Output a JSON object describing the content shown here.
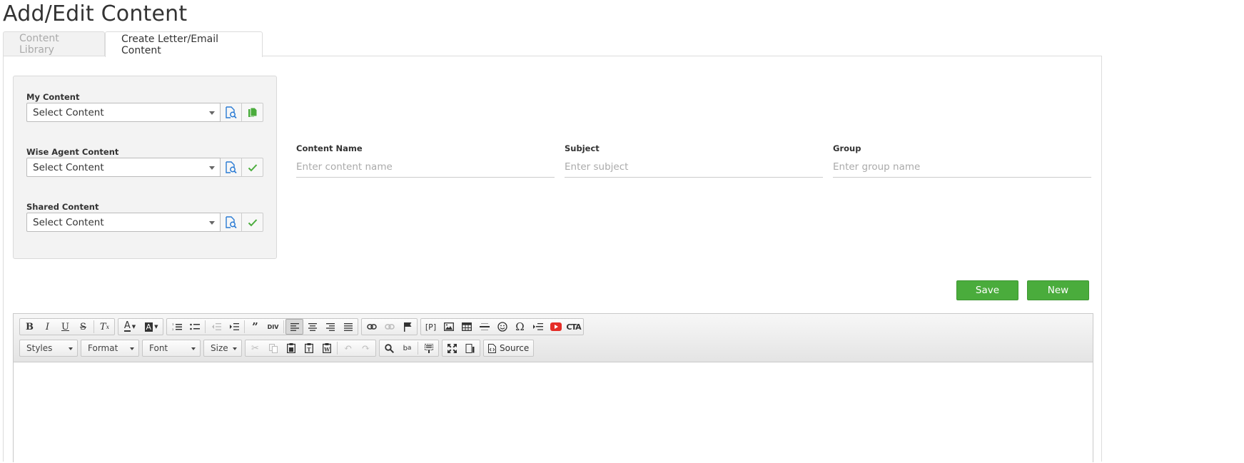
{
  "page": {
    "title": "Add/Edit Content"
  },
  "tabs": [
    {
      "label": "Content Library",
      "active": false
    },
    {
      "label": "Create Letter/Email Content",
      "active": true
    }
  ],
  "sources": [
    {
      "label": "My Content",
      "select_value": "Select Content",
      "action_icon": "copy-icon"
    },
    {
      "label": "Wise Agent Content",
      "select_value": "Select Content",
      "action_icon": "check-icon"
    },
    {
      "label": "Shared Content",
      "select_value": "Select Content",
      "action_icon": "check-icon"
    }
  ],
  "fields": {
    "content_name": {
      "label": "Content Name",
      "placeholder": "Enter content name",
      "value": ""
    },
    "subject": {
      "label": "Subject",
      "placeholder": "Enter subject",
      "value": ""
    },
    "group": {
      "label": "Group",
      "placeholder": "Enter group name",
      "value": ""
    }
  },
  "buttons": {
    "save": "Save",
    "new": "New"
  },
  "editor": {
    "combos": {
      "styles": "Styles",
      "format": "Format",
      "font": "Font",
      "size": "Size"
    },
    "source_label": "Source",
    "placeholder_label": "[P]",
    "cta_label": "CTA",
    "div_label": "DIV"
  },
  "colors": {
    "accent_green": "#4aac3c",
    "icon_blue": "#2a7bd4",
    "youtube_red": "#e52d27"
  }
}
